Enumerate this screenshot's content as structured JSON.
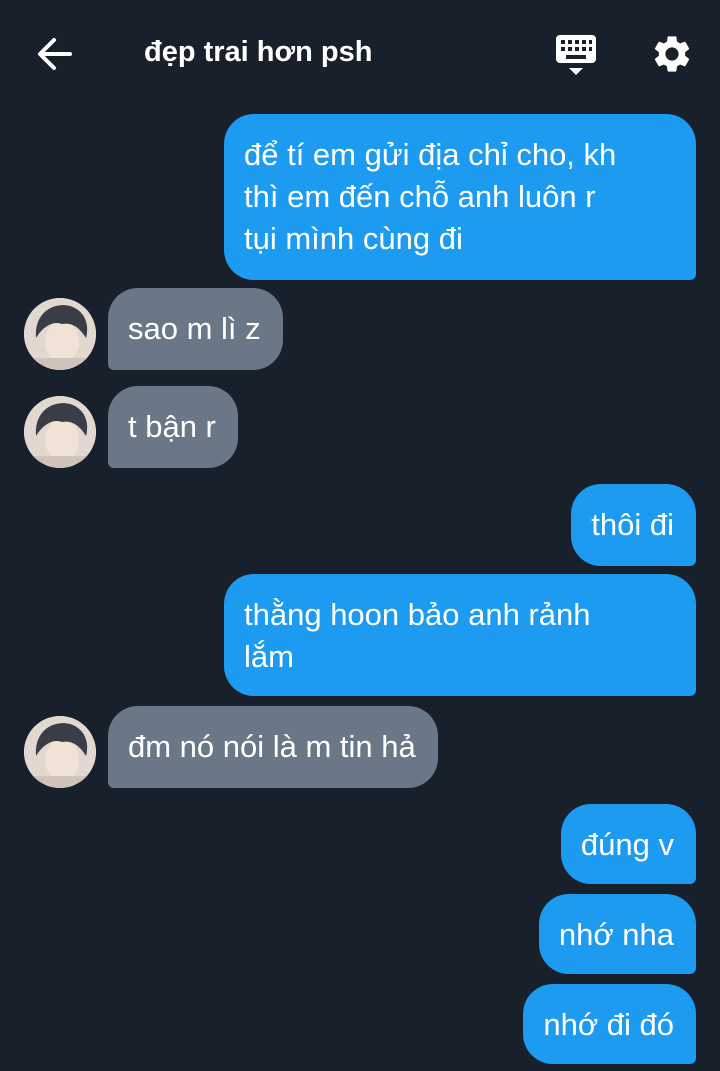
{
  "header": {
    "title": "đẹp trai hơn psh",
    "back_icon": "arrow-left-icon",
    "keyboard_icon": "keyboard-icon",
    "settings_icon": "gear-icon"
  },
  "colors": {
    "background": "#18202c",
    "outgoing_bubble": "#1d9bf0",
    "incoming_bubble": "#6a7787",
    "text": "#ffffff"
  },
  "messages": [
    {
      "direction": "outgoing",
      "text": "để tí em gửi địa chỉ cho, kh\nthì em đến chỗ anh luôn r\ntụi mình cùng đi"
    },
    {
      "direction": "incoming",
      "text": "sao m lì z"
    },
    {
      "direction": "incoming",
      "text": "t bận r"
    },
    {
      "direction": "outgoing",
      "text": "thôi đi"
    },
    {
      "direction": "outgoing",
      "text": "thằng hoon bảo anh rảnh\nlắm"
    },
    {
      "direction": "incoming",
      "text": "đm nó nói là m tin hả"
    },
    {
      "direction": "outgoing",
      "text": "đúng v"
    },
    {
      "direction": "outgoing",
      "text": "nhớ nha"
    },
    {
      "direction": "outgoing",
      "text": "nhớ đi đó"
    }
  ]
}
